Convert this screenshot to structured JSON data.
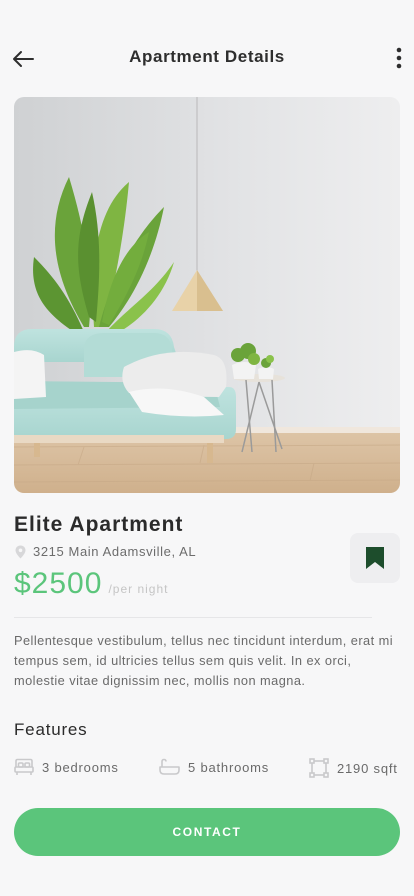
{
  "header": {
    "title": "Apartment Details"
  },
  "listing": {
    "name": "Elite Apartment",
    "address": "3215 Main Adamsville, AL",
    "price": "$2500",
    "price_unit": "/per night",
    "description": "Pellentesque vestibulum, tellus nec tincidunt interdum, erat mi tempus sem, id ultricies tellus sem quis velit. In ex orci, molestie vitae dignissim nec, mollis non magna."
  },
  "features": {
    "title": "Features",
    "items": [
      {
        "icon": "bed-icon",
        "label": "3 bedrooms"
      },
      {
        "icon": "bathtub-icon",
        "label": "5 bathrooms"
      },
      {
        "icon": "area-icon",
        "label": "2190 sqft"
      }
    ]
  },
  "actions": {
    "contact_label": "CONTACT"
  },
  "colors": {
    "accent": "#5bc57b",
    "bookmark": "#1d4d2c",
    "background": "#f7f7f8"
  }
}
